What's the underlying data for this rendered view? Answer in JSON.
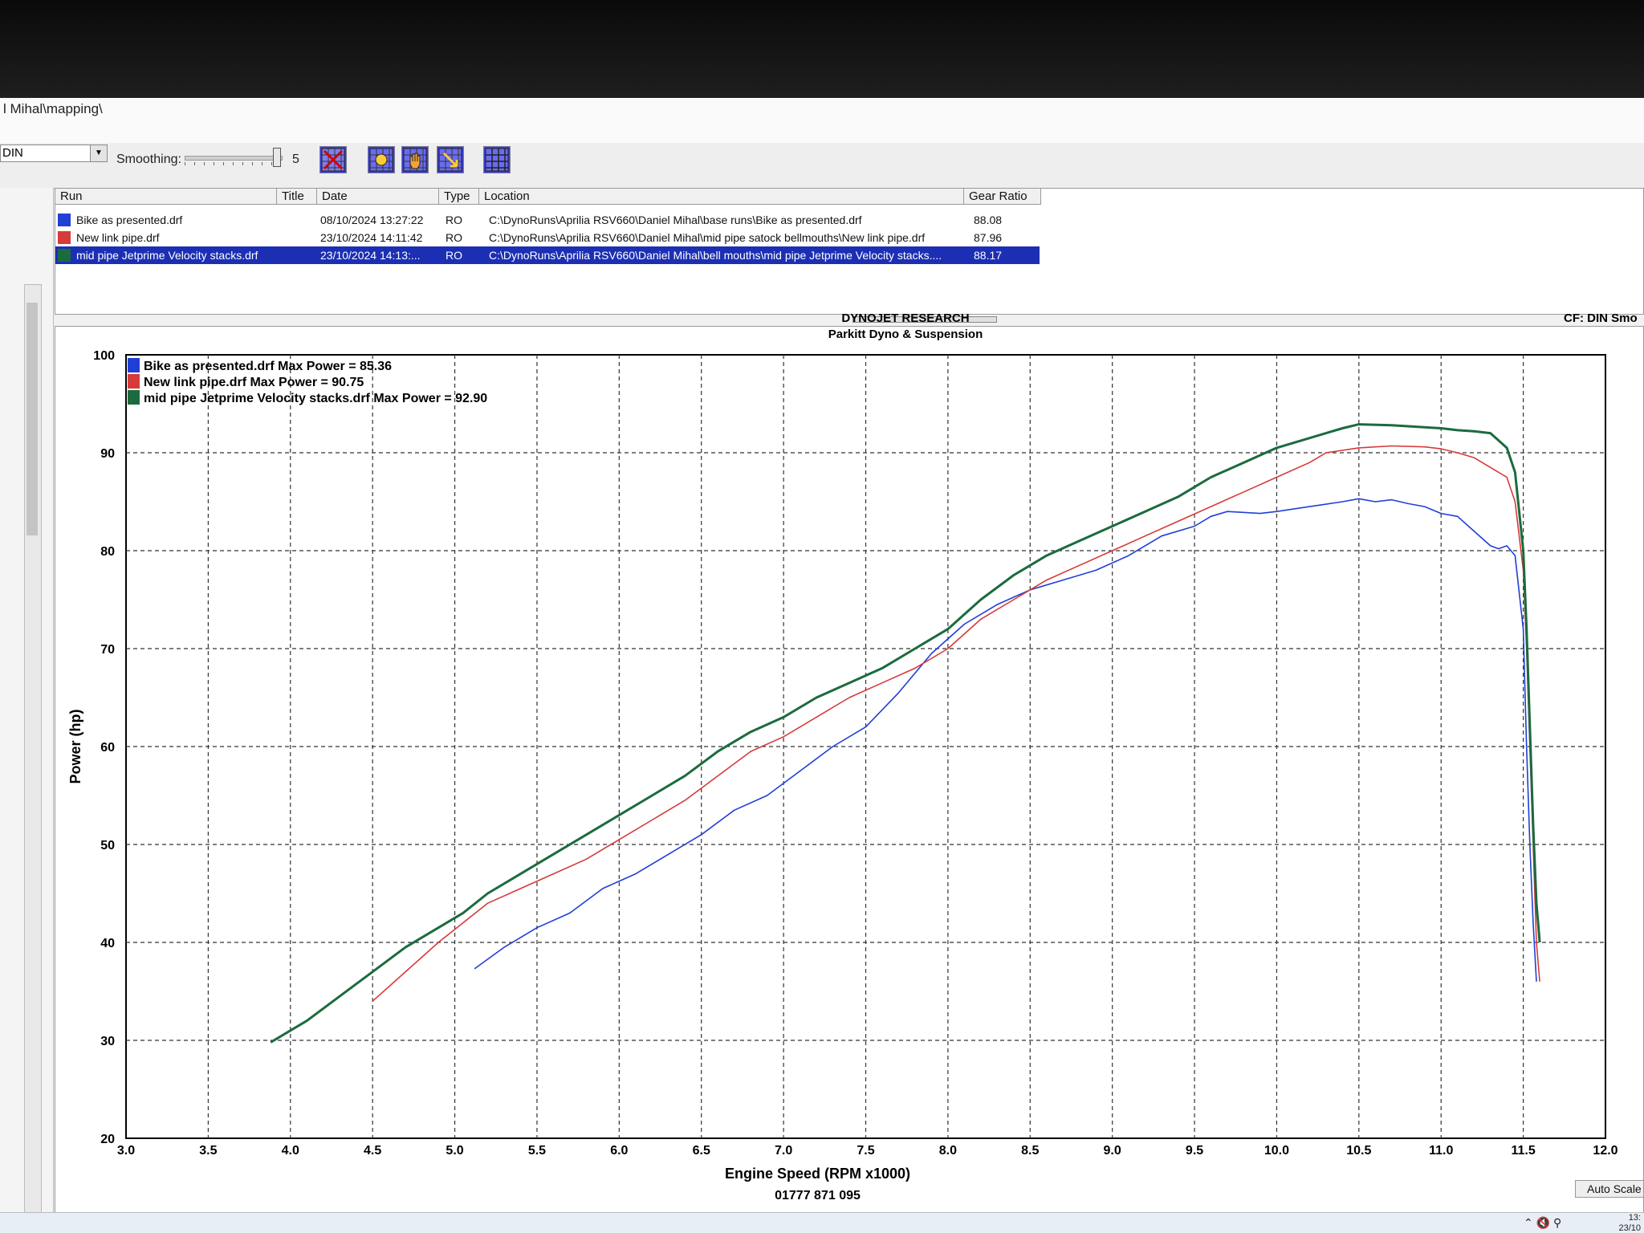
{
  "window": {
    "path": "l Mihal\\mapping\\"
  },
  "toolbar": {
    "correction": "DIN",
    "smoothing_label": "Smoothing:",
    "smoothing_value": "5",
    "buttons": [
      "delete-run-icon",
      "zoom-icon",
      "pan-hand-icon",
      "zoom-reset-icon",
      "grid-toggle-icon"
    ]
  },
  "runs": {
    "headers": {
      "run": "Run",
      "title": "Title",
      "date": "Date",
      "type": "Type",
      "location": "Location",
      "gear_ratio": "Gear Ratio"
    },
    "rows": [
      {
        "name": "Bike as presented.drf",
        "date": "08/10/2024 13:27:22",
        "type": "RO",
        "location": "C:\\DynoRuns\\Aprilia RSV660\\Daniel Mihal\\base runs\\Bike as presented.drf",
        "gear_ratio": "88.08",
        "color": "#1f3fd6",
        "selected": false
      },
      {
        "name": "New link pipe.drf",
        "date": "23/10/2024 14:11:42",
        "type": "RO",
        "location": "C:\\DynoRuns\\Aprilia RSV660\\Daniel Mihal\\mid pipe satock bellmouths\\New link pipe.drf",
        "gear_ratio": "87.96",
        "color": "#d63a3a",
        "selected": false
      },
      {
        "name": "mid pipe Jetprime Velocity stacks.drf",
        "date": "23/10/2024 14:13:...",
        "type": "RO",
        "location": "C:\\DynoRuns\\Aprilia RSV660\\Daniel Mihal\\bell mouths\\mid pipe Jetprime Velocity stacks....",
        "gear_ratio": "88.17",
        "color": "#1b6b3e",
        "selected": true
      }
    ]
  },
  "graph": {
    "title": "DYNOJET RESEARCH",
    "subtitle": "Parkitt Dyno & Suspension",
    "cf_label": "CF: DIN  Smo",
    "footer": "01777 871 095"
  },
  "chart_data": {
    "type": "line",
    "xlabel": "Engine Speed (RPM x1000)",
    "ylabel": "Power (hp)",
    "xlim": [
      3.0,
      12.0
    ],
    "ylim": [
      20,
      100
    ],
    "xticks": [
      "3.0",
      "3.5",
      "4.0",
      "4.5",
      "5.0",
      "5.5",
      "6.0",
      "6.5",
      "7.0",
      "7.5",
      "8.0",
      "8.5",
      "9.0",
      "9.5",
      "10.0",
      "10.5",
      "11.0",
      "11.5",
      "12.0"
    ],
    "yticks": [
      "20",
      "30",
      "40",
      "50",
      "60",
      "70",
      "80",
      "90",
      "100"
    ],
    "grid": true,
    "legend_position": "top-left",
    "series": [
      {
        "name": "Bike as presented.drf",
        "legend": "Bike as presented.drf Max Power = 85.36",
        "color": "#1f3fd6",
        "x": [
          5.12,
          5.3,
          5.5,
          5.7,
          5.9,
          6.1,
          6.25,
          6.35,
          6.5,
          6.7,
          6.9,
          7.1,
          7.3,
          7.5,
          7.7,
          7.9,
          8.1,
          8.3,
          8.5,
          8.7,
          8.9,
          9.1,
          9.3,
          9.5,
          9.6,
          9.7,
          9.9,
          10.0,
          10.2,
          10.4,
          10.5,
          10.6,
          10.7,
          10.8,
          10.9,
          11.0,
          11.1,
          11.2,
          11.3,
          11.35,
          11.4,
          11.45,
          11.5,
          11.52,
          11.54,
          11.56,
          11.58
        ],
        "y": [
          37.3,
          39.5,
          41.5,
          43.0,
          45.5,
          47.0,
          48.5,
          49.5,
          51.0,
          53.5,
          55.0,
          57.5,
          60.0,
          62.0,
          65.5,
          69.5,
          72.5,
          74.5,
          76.0,
          77.0,
          78.0,
          79.5,
          81.5,
          82.5,
          83.5,
          84.0,
          83.8,
          84.0,
          84.5,
          85.0,
          85.3,
          85.0,
          85.2,
          84.8,
          84.5,
          83.8,
          83.5,
          82.0,
          80.5,
          80.2,
          80.5,
          79.5,
          72.0,
          60.0,
          50.0,
          42.0,
          36.0
        ]
      },
      {
        "name": "New link pipe.drf",
        "legend": "New link pipe.drf Max Power = 90.75",
        "color": "#d63a3a",
        "x": [
          4.5,
          4.7,
          4.9,
          5.05,
          5.2,
          5.4,
          5.6,
          5.8,
          6.0,
          6.2,
          6.4,
          6.6,
          6.8,
          7.0,
          7.2,
          7.4,
          7.6,
          7.8,
          8.0,
          8.2,
          8.4,
          8.6,
          8.8,
          9.0,
          9.2,
          9.4,
          9.6,
          9.8,
          10.0,
          10.2,
          10.3,
          10.5,
          10.7,
          10.9,
          11.0,
          11.1,
          11.2,
          11.3,
          11.4,
          11.45,
          11.5,
          11.52,
          11.54,
          11.56,
          11.58,
          11.6
        ],
        "y": [
          34.0,
          37.0,
          40.0,
          42.0,
          44.0,
          45.5,
          47.0,
          48.5,
          50.5,
          52.5,
          54.5,
          57.0,
          59.5,
          61.0,
          63.0,
          65.0,
          66.5,
          68.0,
          70.0,
          73.0,
          75.0,
          77.0,
          78.5,
          80.0,
          81.5,
          83.0,
          84.5,
          86.0,
          87.5,
          89.0,
          90.0,
          90.5,
          90.7,
          90.6,
          90.4,
          90.0,
          89.5,
          88.5,
          87.5,
          85.0,
          78.0,
          70.0,
          60.0,
          50.0,
          40.0,
          36.0
        ]
      },
      {
        "name": "mid pipe Jetprime Velocity stacks.drf",
        "legend": "mid pipe Jetprime Velocity stacks.drf Max Power = 92.90",
        "color": "#1b6b3e",
        "x": [
          3.88,
          4.1,
          4.3,
          4.5,
          4.7,
          4.9,
          5.05,
          5.2,
          5.4,
          5.6,
          5.8,
          6.0,
          6.2,
          6.4,
          6.6,
          6.8,
          7.0,
          7.2,
          7.4,
          7.6,
          7.8,
          8.0,
          8.2,
          8.4,
          8.6,
          8.8,
          9.0,
          9.2,
          9.4,
          9.6,
          9.8,
          10.0,
          10.2,
          10.4,
          10.5,
          10.7,
          10.9,
          11.0,
          11.1,
          11.2,
          11.3,
          11.4,
          11.45,
          11.5,
          11.52,
          11.54,
          11.56,
          11.58,
          11.6
        ],
        "y": [
          29.8,
          32.0,
          34.5,
          37.0,
          39.5,
          41.5,
          43.0,
          45.0,
          47.0,
          49.0,
          51.0,
          53.0,
          55.0,
          57.0,
          59.5,
          61.5,
          63.0,
          65.0,
          66.5,
          68.0,
          70.0,
          72.0,
          75.0,
          77.5,
          79.5,
          81.0,
          82.5,
          84.0,
          85.5,
          87.5,
          89.0,
          90.5,
          91.5,
          92.5,
          92.9,
          92.8,
          92.6,
          92.5,
          92.3,
          92.2,
          92.0,
          90.5,
          88.0,
          80.0,
          72.0,
          62.0,
          52.0,
          44.0,
          40.0
        ]
      }
    ]
  }
}
